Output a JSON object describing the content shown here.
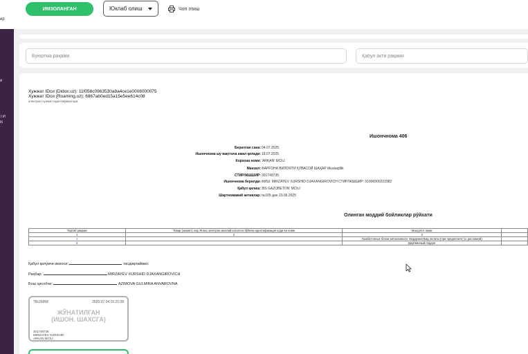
{
  "sidebar": {
    "fragments": [
      "ир",
      "и",
      "ТИ",
      "В"
    ]
  },
  "toolbar": {
    "sign_label": "ИМЗОЛАНГАН",
    "send_label": "Юклаб олиш",
    "print_label": "Чоп этиш"
  },
  "filters": {
    "order_placeholder": "Буюртма рақами",
    "acceptance_placeholder": "Қабул акти рақами"
  },
  "document": {
    "didox_line": "Хужжат IDси (Didox.uz): 11f058c0963530a8a4ce1e0008000075",
    "roaming_line": "Хужжат IDси (Roaming.uz): 6867ab0ed15a15e5ee614c08",
    "id_note": "электрон хужжат идентификатори",
    "title": "Ишончнома 406",
    "fields": [
      {
        "label": "Берилган сана:",
        "value": "04.07.2025"
      },
      {
        "label": "Ишончнома шу вақтгача амал қилади:",
        "value": "18.07.2025"
      },
      {
        "label": "Корхона номи:",
        "value": "'ARKAN' MChJ"
      },
      {
        "label": "Манзил:",
        "value": "ФАРҒОНА ВИЛОЯТИ ҚУВАСОЙ ШАҲАР Mustaqillik"
      },
      {
        "label": "СТИР/ЖШШИР:",
        "value": "301749735"
      },
      {
        "label": "Ишончнома берилди:",
        "value": "ФИШ:   MIRZAYEV XURSHID DJAXANGIROVICH     СТИР/ЖШШИР:    31006900222382"
      },
      {
        "label": "Қабул қилиш:",
        "value": "'BS GAZOBETON' MChJ"
      },
      {
        "label": "Шартномавий активлар:",
        "value": "№105 дан 23.06.2025"
      }
    ],
    "goods_title": "Олинган моддий бойликлар рўйхати",
    "table": {
      "headers": [
        "Тартиб рақами",
        "Товар (хизмат) лар Ягона электрон миллий каталоги бўйича идентификация коди ва номи",
        "Махсулот номи",
        ""
      ],
      "number_row": [
        "1",
        "2",
        "3",
        ""
      ],
      "rows": [
        [
          "1",
          "",
          "Газобетонные блоки автоклавного твердения Вид оплаты (при предоплате) (с доставкой)",
          ""
        ],
        [
          "2",
          "",
          "Деревянный поддон",
          ""
        ]
      ]
    },
    "signatures": {
      "receiver_prefix": "Қабул қилувчи имзоси:",
      "receiver_suffix": "тасдиқлаймиз:",
      "head_label": "Раҳбар:",
      "head_name": "MIRZAYEV XURSHID DJAXANGIROVICH",
      "accountant_label": "Бош ҳисобчи:",
      "accountant_name": "AZIMOVA GULMIRA ANVAROVNA"
    },
    "stamp": {
      "number": "78c2b958",
      "datetime": "2025.07.04 15:21:08",
      "line1": "ЖЎНАТИЛГАН",
      "line2": "(ИШОН. ШАХСГА)",
      "tin": "301749735",
      "person": "MIRZAYEV XURSHID",
      "company": "ARKAN MChJ"
    }
  }
}
